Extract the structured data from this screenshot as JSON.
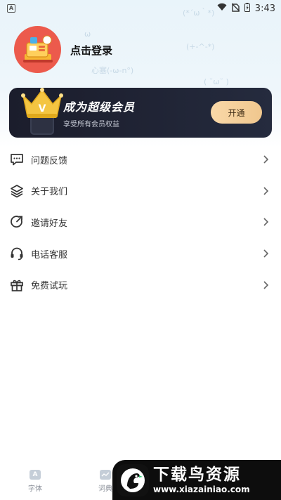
{
  "status_bar": {
    "app_indicator": "A",
    "time": "3:43"
  },
  "profile": {
    "login_prompt": "点击登录"
  },
  "vip": {
    "title": "成为超级会员",
    "subtitle": "享受所有会员权益",
    "button_label": "开通",
    "crown_letter": "V",
    "colors": {
      "card": "#1f2233",
      "button": "#f5d09c",
      "crown": "#f4c542"
    }
  },
  "menu": {
    "items": [
      {
        "label": "问题反馈",
        "icon": "feedback-icon"
      },
      {
        "label": "关于我们",
        "icon": "layers-icon"
      },
      {
        "label": "邀请好友",
        "icon": "share-icon"
      },
      {
        "label": "电话客服",
        "icon": "headset-icon"
      },
      {
        "label": "免费试玩",
        "icon": "gift-icon"
      }
    ]
  },
  "bottom_nav": {
    "items": [
      {
        "label": "字体",
        "icon": "font-icon"
      },
      {
        "label": "词典",
        "icon": "dictionary-icon"
      }
    ]
  },
  "watermark": {
    "title": "下载鸟资源",
    "url": "www.xiazainiao.com"
  },
  "doodles": [
    "心塞(-ω-n°)",
    "(*´ω｀*)",
    "ω",
    "(+-^-*)",
    "( ˘ω˘ )"
  ]
}
